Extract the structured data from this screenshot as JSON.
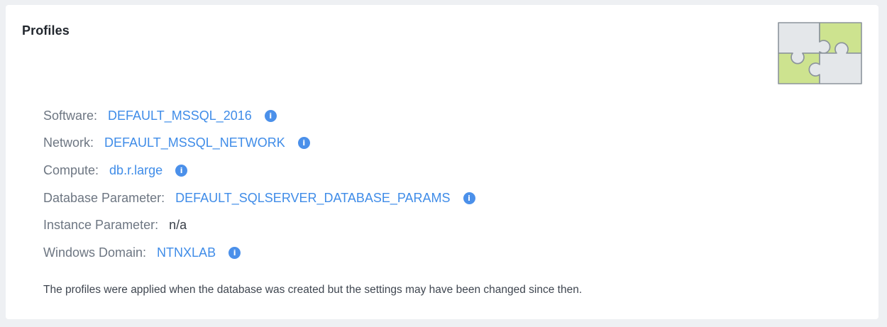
{
  "card": {
    "title": "Profiles"
  },
  "profiles": [
    {
      "label": "Software:",
      "value": "DEFAULT_MSSQL_2016",
      "link": true,
      "info": true
    },
    {
      "label": "Network:",
      "value": "DEFAULT_MSSQL_NETWORK",
      "link": true,
      "info": true
    },
    {
      "label": "Compute:",
      "value": "db.r.large",
      "link": true,
      "info": true
    },
    {
      "label": "Database Parameter:",
      "value": "DEFAULT_SQLSERVER_DATABASE_PARAMS",
      "link": true,
      "info": true
    },
    {
      "label": "Instance Parameter:",
      "value": "n/a",
      "link": false,
      "info": false
    },
    {
      "label": "Windows Domain:",
      "value": "NTNXLAB",
      "link": true,
      "info": true
    }
  ],
  "info_icon": {
    "name": "info-icon",
    "glyph": "i"
  },
  "illustration": {
    "name": "puzzle-pieces-icon"
  },
  "note": "The profiles were applied when the database was created but the settings may have been changed since then.",
  "colors": {
    "link": "#3f8ce8",
    "info_icon": "#4b90ea",
    "puzzle_green": "#cde38f",
    "puzzle_gray": "#e4e7ea"
  }
}
